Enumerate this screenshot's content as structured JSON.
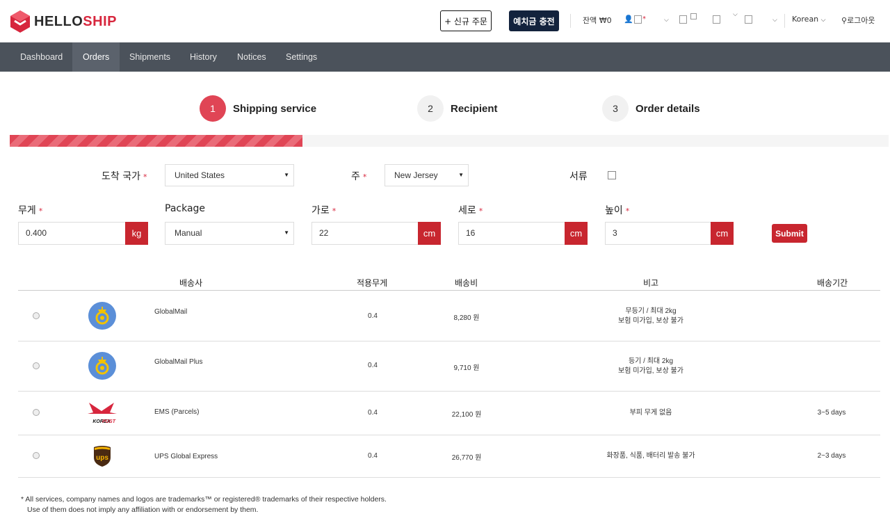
{
  "header": {
    "logo_left": "HELLO",
    "logo_right": "SHIP",
    "new_order_label": "+ 신규 주문",
    "charge_label": "예치금 충전",
    "balance": "잔액 ₩0",
    "language": "Korean",
    "logout": "로그아웃"
  },
  "nav": {
    "items": [
      {
        "label": "Dashboard"
      },
      {
        "label": "Orders"
      },
      {
        "label": "Shipments"
      },
      {
        "label": "History"
      },
      {
        "label": "Notices"
      },
      {
        "label": "Settings"
      }
    ],
    "active": "Orders"
  },
  "steps": [
    {
      "num": "1",
      "label": "Shipping service",
      "state": "active"
    },
    {
      "num": "2",
      "label": "Recipient",
      "state": "idle"
    },
    {
      "num": "3",
      "label": "Order details",
      "state": "idle"
    }
  ],
  "progress": {
    "percent": 33.3
  },
  "form": {
    "country_label": "도착 국가",
    "country_value": "United States",
    "state_label": "주",
    "state_value": "New Jersey",
    "documents_label": "서류",
    "documents_checked": false,
    "weight_label": "무게",
    "weight_value": "0.400",
    "weight_unit": "kg",
    "package_label": "Package",
    "package_value": "Manual",
    "width_label": "가로",
    "width_value": "22",
    "length_label": "세로",
    "length_value": "16",
    "height_label": "높이",
    "height_value": "3",
    "length_unit": "cm",
    "required_mark": "*",
    "submit_label": "Submit"
  },
  "table": {
    "headers": {
      "carrier": "배송사",
      "applied_weight": "적용무게",
      "fee": "배송비",
      "notes": "비고",
      "delivery_time": "배송기간"
    },
    "rows": [
      {
        "carrier": "GlobalMail",
        "logo": "posthorn-icon",
        "weight": "0.4",
        "fee": "8,280 원",
        "note1": "무등기 / 최대 2kg",
        "note2": "보험 미가입, 보상 불가",
        "days": ""
      },
      {
        "carrier": "GlobalMail Plus",
        "logo": "posthorn-icon",
        "weight": "0.4",
        "fee": "9,710 원",
        "note1": "등기 / 최대 2kg",
        "note2": "보험 미가입, 보상 불가",
        "days": ""
      },
      {
        "carrier": "EMS (Parcels)",
        "logo": "korea-post-logo",
        "weight": "0.4",
        "fee": "22,100 원",
        "note1": "부피 무게 없음",
        "note2": "",
        "days": "3~5 days"
      },
      {
        "carrier": "UPS Global Express",
        "logo": "ups-logo",
        "weight": "0.4",
        "fee": "26,770 원",
        "note1": "화장품, 식품, 배터리 발송 불가",
        "note2": "",
        "days": "2~3 days"
      }
    ]
  },
  "footnote": {
    "line1": "* All services, company names and logos are trademarks™ or registered® trademarks of their respective holders.",
    "line2": "Use of them does not imply any affiliation with or endorsement by them."
  },
  "colors": {
    "brand_red": "#c8262f",
    "step_red": "#e04555",
    "nav_bg": "#4b525b",
    "charge_btn": "#13233d"
  }
}
